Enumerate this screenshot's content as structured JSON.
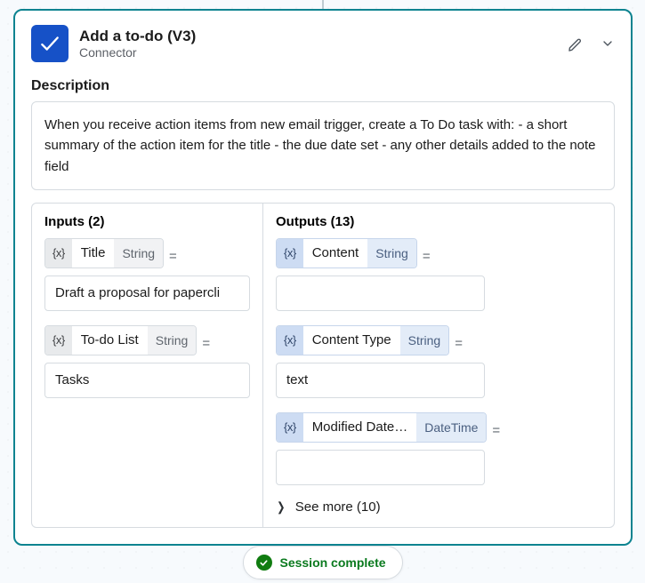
{
  "header": {
    "title": "Add a to-do (V3)",
    "subtitle": "Connector"
  },
  "description": {
    "label": "Description",
    "text": "When you receive action items from new email trigger, create a To Do task with: - a short summary of the action item for the title - the due date set - any other details added to the note field"
  },
  "inputs": {
    "title": "Inputs (2)",
    "items": [
      {
        "chip": "{x}",
        "name": "Title",
        "type": "String",
        "value": "Draft a proposal for papercli"
      },
      {
        "chip": "{x}",
        "name": "To-do List",
        "type": "String",
        "value": "Tasks"
      }
    ]
  },
  "outputs": {
    "title": "Outputs (13)",
    "items": [
      {
        "chip": "{x}",
        "name": "Content",
        "type": "String",
        "value": ""
      },
      {
        "chip": "{x}",
        "name": "Content Type",
        "type": "String",
        "value": "text"
      },
      {
        "chip": "{x}",
        "name": "Modified Date…",
        "type": "DateTime",
        "value": ""
      }
    ],
    "see_more": "See more (10)"
  },
  "status": {
    "text": "Session complete"
  },
  "eq": "="
}
